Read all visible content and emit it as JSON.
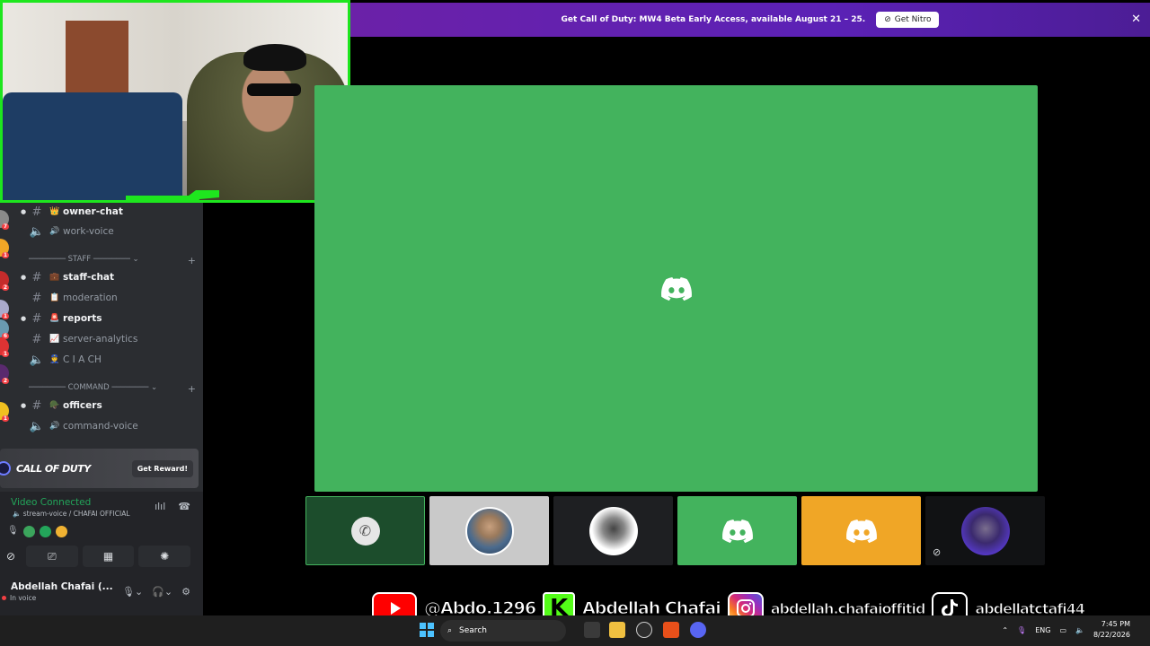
{
  "banner": {
    "text": "Get Call of Duty: MW4 Beta Early Access, available August 21 – 25.",
    "button": "Get Nitro",
    "close": "✕"
  },
  "channels": [
    {
      "type": "text",
      "emoji": "👑",
      "name": "owner-chat",
      "bold": true
    },
    {
      "type": "voice",
      "emoji": "🔊",
      "name": "work-voice",
      "bold": false
    }
  ],
  "categories": {
    "staff": "STAFF",
    "command": "COMMAND"
  },
  "staff_channels": [
    {
      "type": "text",
      "emoji": "💼",
      "name": "staff-chat",
      "bold": true
    },
    {
      "type": "text",
      "emoji": "📋",
      "name": "moderation",
      "bold": false
    },
    {
      "type": "text",
      "emoji": "🚨",
      "name": "reports",
      "bold": true
    },
    {
      "type": "text",
      "emoji": "📈",
      "name": "server-analytics",
      "bold": false
    },
    {
      "type": "voice",
      "emoji": "👮",
      "name": "C I A CH",
      "bold": false
    }
  ],
  "command_channels": [
    {
      "type": "text",
      "emoji": "🪖",
      "name": "officers",
      "bold": true
    },
    {
      "type": "voice",
      "emoji": "🔊",
      "name": "command-voice",
      "bold": false
    }
  ],
  "server_badges": [
    "7",
    "1",
    "2",
    "1",
    "6",
    "1",
    "2",
    "1"
  ],
  "reward": {
    "logo": "CALL OF DUTY",
    "button": "Get Reward!"
  },
  "voice": {
    "status": "Video Connected",
    "channel": "stream-voice / CHAFAI OFFICIAL"
  },
  "user": {
    "name": "Abdellah Chafai (...",
    "status": "In voice"
  },
  "socials": {
    "youtube": "@Abdo.1296",
    "kick": "Abdellah Chafai",
    "instagram": "abdellah.chafaioffitid",
    "tiktok": "abdellatctafi44",
    "kick_letter": "K"
  },
  "taskbar": {
    "search": "Search",
    "lang": "ENG",
    "time": "7:45 PM",
    "date": "8/22/2026"
  },
  "colors": {
    "stage_green": "#43b35d",
    "tile_orange": "#f0a626",
    "banner_purple": "#6b21a8",
    "connected": "#23a55a"
  }
}
